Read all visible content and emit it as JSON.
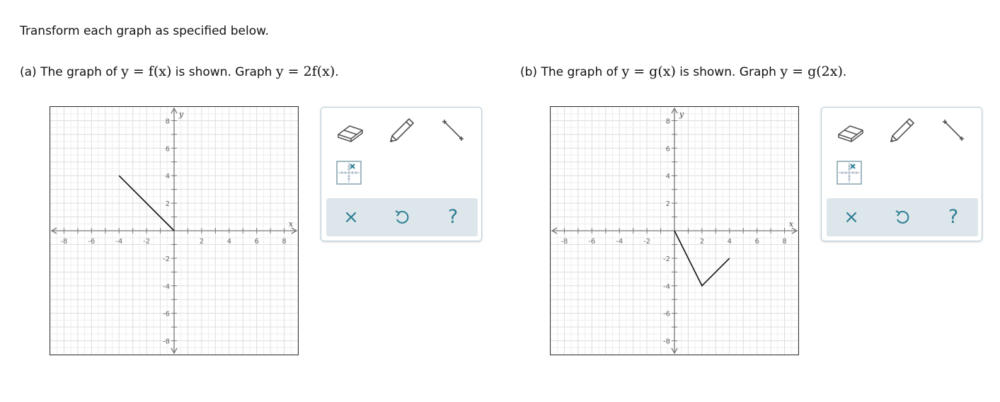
{
  "instructions": "Transform each graph as specified below.",
  "parts": {
    "a": {
      "prefix": "(a)  The graph of ",
      "given_eq": "y = f(x)",
      "mid": " is shown. Graph ",
      "target_eq": "y = 2f(x)",
      "suffix": "."
    },
    "b": {
      "prefix": "(b)  The graph of ",
      "given_eq": "y = g(x)",
      "mid": " is shown. Graph ",
      "target_eq": "y = g(2x)",
      "suffix": "."
    }
  },
  "axes": {
    "x_label": "x",
    "y_label": "y",
    "x_ticks": [
      "-8",
      "-6",
      "-4",
      "-2",
      "2",
      "4",
      "6",
      "8"
    ],
    "y_ticks_pos": [
      "8",
      "6",
      "4",
      "2"
    ],
    "y_ticks_neg": [
      "-2",
      "-4",
      "-6",
      "-8"
    ],
    "xlim": [
      -9,
      9
    ],
    "ylim": [
      -9,
      9
    ]
  },
  "chart_data": [
    {
      "type": "line",
      "graph": "a",
      "x": [
        -4,
        0
      ],
      "y": [
        4,
        0
      ]
    },
    {
      "type": "line",
      "graph": "b",
      "x": [
        0,
        2,
        4
      ],
      "y": [
        0,
        -4,
        -2
      ]
    }
  ],
  "tools": {
    "eraser_icon": "eraser-icon",
    "pencil_icon": "pencil-icon",
    "line_icon": "line-segment-icon",
    "point_icon": "point-grid-icon"
  },
  "actions": {
    "clear_symbol": "×",
    "help_symbol": "?"
  },
  "colors": {
    "accent": "#2e7f95",
    "action_bar": "#dde6ea",
    "toolbox_border": "#b5cdd8",
    "grid": "#dddddd",
    "axis": "#777777",
    "curve": "#111111"
  }
}
